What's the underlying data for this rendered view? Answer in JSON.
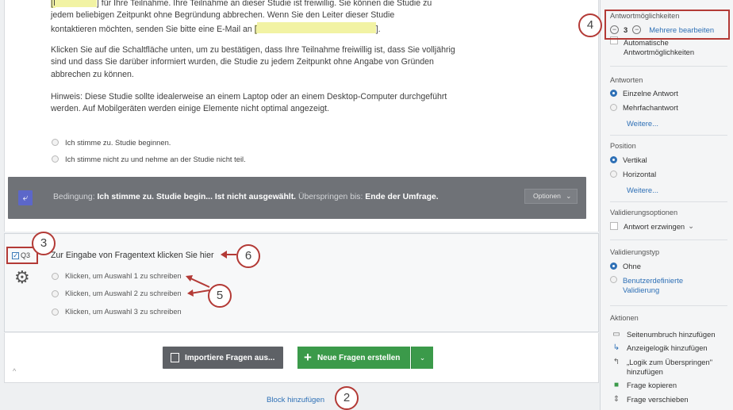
{
  "intro": {
    "line1_hl": "[I",
    "line1": "] für Ihre Teilnahme. Ihre Teilnahme an dieser Studie ist freiwillig. Sie können die Studie zu",
    "line2": "jedem beliebigen Zeitpunkt ohne Begründung abbrechen. Wenn Sie den Leiter dieser Studie",
    "line3a": "kontaktieren möchten, senden Sie bitte eine E-Mail an",
    "line3_hl": "[",
    "line3b": "].",
    "para2": "Klicken Sie auf die Schaltfläche unten, um zu bestätigen, dass Ihre Teilnahme freiwillig ist, dass Sie volljährig sind und dass Sie darüber informiert wurden, die Studie zu jedem Zeitpunkt ohne Angabe von Gründen abbrechen zu können.",
    "para3": "Hinweis: Diese Studie sollte idealerweise an einem Laptop oder an einem Desktop-Computer durchgeführt werden.  Auf Mobilgeräten werden einige Elemente nicht optimal angezeigt.",
    "choices": [
      "Ich stimme zu. Studie beginnen.",
      "Ich stimme nicht zu und nehme an der Studie nicht teil."
    ]
  },
  "condition": {
    "label": "Bedingung:",
    "cond": "Ich stimme zu. Studie begin... Ist nicht ausgewählt.",
    "skip_label": "Überspringen bis:",
    "skip_target": "Ende der Umfrage.",
    "options": "Optionen"
  },
  "q3": {
    "id": "Q3",
    "text": "Zur Eingabe von Fragentext klicken Sie hier",
    "choices": [
      "Klicken, um Auswahl 1 zu schreiben",
      "Klicken, um Auswahl 2 zu schreiben",
      "Klicken, um Auswahl 3 zu schreiben"
    ]
  },
  "buttons": {
    "import": "Importiere Fragen aus...",
    "new": "Neue Fragen erstellen",
    "add_block": "Block hinzufügen"
  },
  "callouts": [
    "2",
    "3",
    "4",
    "5",
    "6"
  ],
  "panel": {
    "choices_title": "Antwortmöglichkeiten",
    "choices_count": "3",
    "edit_multiple": "Mehrere bearbeiten",
    "auto_choices": "Automatische Antwortmöglichkeiten",
    "answers_title": "Antworten",
    "single": "Einzelne Antwort",
    "multi": "Mehrfachantwort",
    "more1": "Weitere...",
    "position_title": "Position",
    "vertical": "Vertikal",
    "horizontal": "Horizontal",
    "more2": "Weitere...",
    "validation_title": "Validierungsoptionen",
    "force": "Antwort erzwingen",
    "vtype_title": "Validierungstyp",
    "none": "Ohne",
    "custom": "Benutzerdefinierte Validierung",
    "actions_title": "Aktionen",
    "actions": [
      "Seitenumbruch hinzufügen",
      "Anzeigelogik hinzufügen",
      "„Logik zum Überspringen\" hinzufügen",
      "Frage kopieren",
      "Frage verschieben"
    ]
  },
  "colors": {
    "accent": "#2e70b6",
    "green": "#3b9a4a",
    "callout": "#b33a36",
    "highlight": "#f2f3a4"
  }
}
